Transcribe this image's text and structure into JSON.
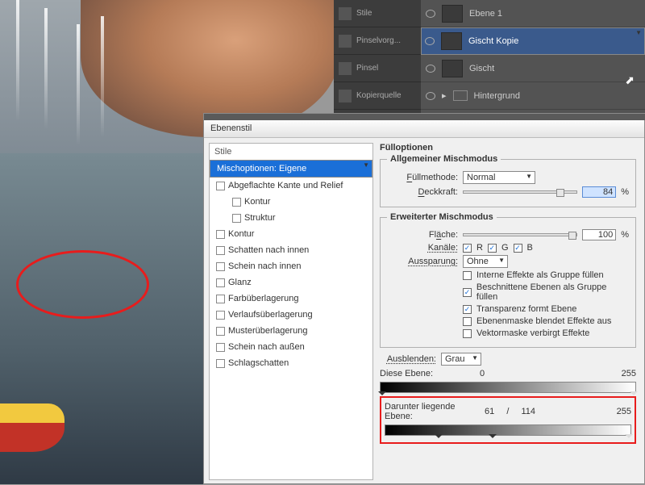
{
  "tools": [
    {
      "label": "Stile"
    },
    {
      "label": "Pinselvorg..."
    },
    {
      "label": "Pinsel"
    },
    {
      "label": "Kopierquelle"
    }
  ],
  "layers": [
    {
      "name": "Ebene 1",
      "selected": false
    },
    {
      "name": "Gischt Kopie",
      "selected": true
    },
    {
      "name": "Gischt",
      "selected": false
    },
    {
      "name": "Hintergrund",
      "selected": false,
      "folder": true
    }
  ],
  "dialog": {
    "title": "Ebenenstil",
    "styles_header": "Stile",
    "styles": [
      {
        "label": "Mischoptionen: Eigene",
        "selected": true,
        "check": false
      },
      {
        "label": "Abgeflachte Kante und Relief",
        "check": true
      },
      {
        "label": "Kontur",
        "check": true,
        "indent": true
      },
      {
        "label": "Struktur",
        "check": true,
        "indent": true
      },
      {
        "label": "Kontur",
        "check": true
      },
      {
        "label": "Schatten nach innen",
        "check": true
      },
      {
        "label": "Schein nach innen",
        "check": true
      },
      {
        "label": "Glanz",
        "check": true
      },
      {
        "label": "Farbüberlagerung",
        "check": true
      },
      {
        "label": "Verlaufsüberlagerung",
        "check": true
      },
      {
        "label": "Musterüberlagerung",
        "check": true
      },
      {
        "label": "Schein nach außen",
        "check": true
      },
      {
        "label": "Schlagschatten",
        "check": true
      }
    ],
    "fill_header": "Fülloptionen",
    "general_header": "Allgemeiner Mischmodus",
    "fill_method_label": "Füllmethode:",
    "fill_method_value": "Normal",
    "opacity_label": "Deckkraft:",
    "opacity_value": "84",
    "percent": "%",
    "adv_header": "Erweiterter Mischmodus",
    "area_label": "Fläche:",
    "area_value": "100",
    "channels_label": "Kanäle:",
    "ch_r": "R",
    "ch_g": "G",
    "ch_b": "B",
    "knockout_label": "Aussparung:",
    "knockout_value": "Ohne",
    "adv_checks": [
      {
        "on": false,
        "label": "Interne Effekte als Gruppe füllen"
      },
      {
        "on": true,
        "label": "Beschnittene Ebenen als Gruppe füllen"
      },
      {
        "on": true,
        "label": "Transparenz formt Ebene"
      },
      {
        "on": false,
        "label": "Ebenenmaske blendet Effekte aus"
      },
      {
        "on": false,
        "label": "Vektormaske verbirgt Effekte"
      }
    ],
    "blendif_label": "Ausblenden:",
    "blendif_value": "Grau",
    "this_layer_label": "Diese Ebene:",
    "this_low": "0",
    "this_high": "255",
    "under_label": "Darunter liegende Ebene:",
    "under_low": "61",
    "under_sep": "/",
    "under_mid": "114",
    "under_high": "255"
  }
}
